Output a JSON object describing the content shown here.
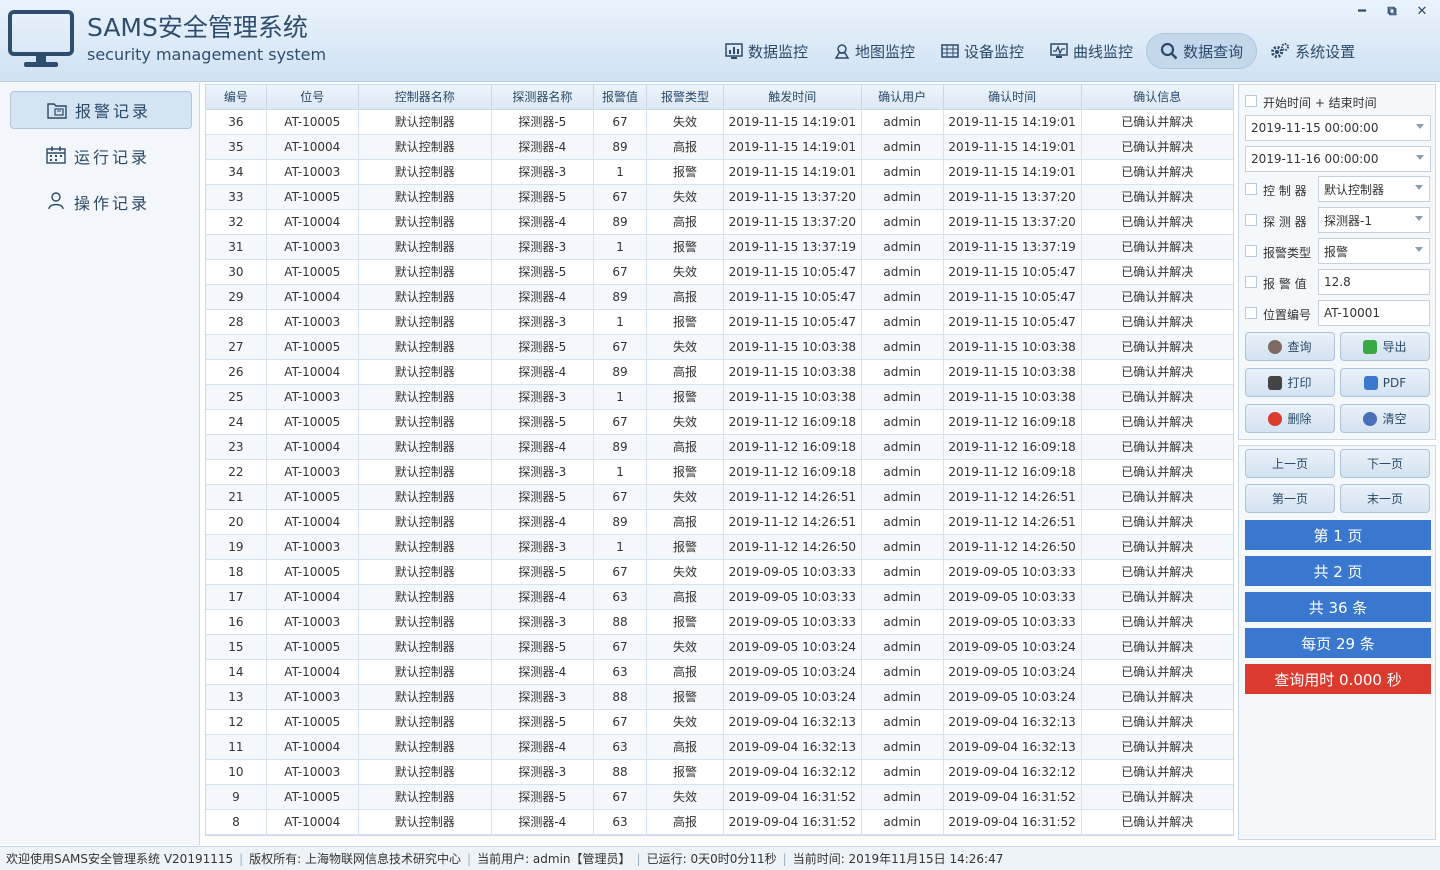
{
  "app": {
    "title": "SAMS安全管理系统",
    "subtitle": "security management system"
  },
  "window_controls": {
    "minimize": "━",
    "restore": "⧉",
    "close": "✕"
  },
  "nav": [
    {
      "label": "数据监控",
      "icon": "bar-chart-icon"
    },
    {
      "label": "地图监控",
      "icon": "map-pin-icon"
    },
    {
      "label": "设备监控",
      "icon": "device-grid-icon"
    },
    {
      "label": "曲线监控",
      "icon": "curve-monitor-icon"
    },
    {
      "label": "数据查询",
      "icon": "search-icon"
    },
    {
      "label": "系统设置",
      "icon": "gear-icon"
    }
  ],
  "nav_active": "数据查询",
  "sidebar": [
    {
      "label": "报警记录",
      "icon": "alarm-record-icon"
    },
    {
      "label": "运行记录",
      "icon": "calendar-icon"
    },
    {
      "label": "操作记录",
      "icon": "user-icon"
    }
  ],
  "table": {
    "columns": [
      "编号",
      "位号",
      "控制器名称",
      "探测器名称",
      "报警值",
      "报警类型",
      "触发时间",
      "确认用户",
      "确认时间",
      "确认信息"
    ],
    "rows": [
      [
        "36",
        "AT-10005",
        "默认控制器",
        "探测器-5",
        "67",
        "失效",
        "2019-11-15 14:19:01",
        "admin",
        "2019-11-15 14:19:01",
        "已确认并解决"
      ],
      [
        "35",
        "AT-10004",
        "默认控制器",
        "探测器-4",
        "89",
        "高报",
        "2019-11-15 14:19:01",
        "admin",
        "2019-11-15 14:19:01",
        "已确认并解决"
      ],
      [
        "34",
        "AT-10003",
        "默认控制器",
        "探测器-3",
        "1",
        "报警",
        "2019-11-15 14:19:01",
        "admin",
        "2019-11-15 14:19:01",
        "已确认并解决"
      ],
      [
        "33",
        "AT-10005",
        "默认控制器",
        "探测器-5",
        "67",
        "失效",
        "2019-11-15 13:37:20",
        "admin",
        "2019-11-15 13:37:20",
        "已确认并解决"
      ],
      [
        "32",
        "AT-10004",
        "默认控制器",
        "探测器-4",
        "89",
        "高报",
        "2019-11-15 13:37:20",
        "admin",
        "2019-11-15 13:37:20",
        "已确认并解决"
      ],
      [
        "31",
        "AT-10003",
        "默认控制器",
        "探测器-3",
        "1",
        "报警",
        "2019-11-15 13:37:19",
        "admin",
        "2019-11-15 13:37:19",
        "已确认并解决"
      ],
      [
        "30",
        "AT-10005",
        "默认控制器",
        "探测器-5",
        "67",
        "失效",
        "2019-11-15 10:05:47",
        "admin",
        "2019-11-15 10:05:47",
        "已确认并解决"
      ],
      [
        "29",
        "AT-10004",
        "默认控制器",
        "探测器-4",
        "89",
        "高报",
        "2019-11-15 10:05:47",
        "admin",
        "2019-11-15 10:05:47",
        "已确认并解决"
      ],
      [
        "28",
        "AT-10003",
        "默认控制器",
        "探测器-3",
        "1",
        "报警",
        "2019-11-15 10:05:47",
        "admin",
        "2019-11-15 10:05:47",
        "已确认并解决"
      ],
      [
        "27",
        "AT-10005",
        "默认控制器",
        "探测器-5",
        "67",
        "失效",
        "2019-11-15 10:03:38",
        "admin",
        "2019-11-15 10:03:38",
        "已确认并解决"
      ],
      [
        "26",
        "AT-10004",
        "默认控制器",
        "探测器-4",
        "89",
        "高报",
        "2019-11-15 10:03:38",
        "admin",
        "2019-11-15 10:03:38",
        "已确认并解决"
      ],
      [
        "25",
        "AT-10003",
        "默认控制器",
        "探测器-3",
        "1",
        "报警",
        "2019-11-15 10:03:38",
        "admin",
        "2019-11-15 10:03:38",
        "已确认并解决"
      ],
      [
        "24",
        "AT-10005",
        "默认控制器",
        "探测器-5",
        "67",
        "失效",
        "2019-11-12 16:09:18",
        "admin",
        "2019-11-12 16:09:18",
        "已确认并解决"
      ],
      [
        "23",
        "AT-10004",
        "默认控制器",
        "探测器-4",
        "89",
        "高报",
        "2019-11-12 16:09:18",
        "admin",
        "2019-11-12 16:09:18",
        "已确认并解决"
      ],
      [
        "22",
        "AT-10003",
        "默认控制器",
        "探测器-3",
        "1",
        "报警",
        "2019-11-12 16:09:18",
        "admin",
        "2019-11-12 16:09:18",
        "已确认并解决"
      ],
      [
        "21",
        "AT-10005",
        "默认控制器",
        "探测器-5",
        "67",
        "失效",
        "2019-11-12 14:26:51",
        "admin",
        "2019-11-12 14:26:51",
        "已确认并解决"
      ],
      [
        "20",
        "AT-10004",
        "默认控制器",
        "探测器-4",
        "89",
        "高报",
        "2019-11-12 14:26:51",
        "admin",
        "2019-11-12 14:26:51",
        "已确认并解决"
      ],
      [
        "19",
        "AT-10003",
        "默认控制器",
        "探测器-3",
        "1",
        "报警",
        "2019-11-12 14:26:50",
        "admin",
        "2019-11-12 14:26:50",
        "已确认并解决"
      ],
      [
        "18",
        "AT-10005",
        "默认控制器",
        "探测器-5",
        "67",
        "失效",
        "2019-09-05 10:03:33",
        "admin",
        "2019-09-05 10:03:33",
        "已确认并解决"
      ],
      [
        "17",
        "AT-10004",
        "默认控制器",
        "探测器-4",
        "63",
        "高报",
        "2019-09-05 10:03:33",
        "admin",
        "2019-09-05 10:03:33",
        "已确认并解决"
      ],
      [
        "16",
        "AT-10003",
        "默认控制器",
        "探测器-3",
        "88",
        "报警",
        "2019-09-05 10:03:33",
        "admin",
        "2019-09-05 10:03:33",
        "已确认并解决"
      ],
      [
        "15",
        "AT-10005",
        "默认控制器",
        "探测器-5",
        "67",
        "失效",
        "2019-09-05 10:03:24",
        "admin",
        "2019-09-05 10:03:24",
        "已确认并解决"
      ],
      [
        "14",
        "AT-10004",
        "默认控制器",
        "探测器-4",
        "63",
        "高报",
        "2019-09-05 10:03:24",
        "admin",
        "2019-09-05 10:03:24",
        "已确认并解决"
      ],
      [
        "13",
        "AT-10003",
        "默认控制器",
        "探测器-3",
        "88",
        "报警",
        "2019-09-05 10:03:24",
        "admin",
        "2019-09-05 10:03:24",
        "已确认并解决"
      ],
      [
        "12",
        "AT-10005",
        "默认控制器",
        "探测器-5",
        "67",
        "失效",
        "2019-09-04 16:32:13",
        "admin",
        "2019-09-04 16:32:13",
        "已确认并解决"
      ],
      [
        "11",
        "AT-10004",
        "默认控制器",
        "探测器-4",
        "63",
        "高报",
        "2019-09-04 16:32:13",
        "admin",
        "2019-09-04 16:32:13",
        "已确认并解决"
      ],
      [
        "10",
        "AT-10003",
        "默认控制器",
        "探测器-3",
        "88",
        "报警",
        "2019-09-04 16:32:12",
        "admin",
        "2019-09-04 16:32:12",
        "已确认并解决"
      ],
      [
        "9",
        "AT-10005",
        "默认控制器",
        "探测器-5",
        "67",
        "失效",
        "2019-09-04 16:31:52",
        "admin",
        "2019-09-04 16:31:52",
        "已确认并解决"
      ],
      [
        "8",
        "AT-10004",
        "默认控制器",
        "探测器-4",
        "63",
        "高报",
        "2019-09-04 16:31:52",
        "admin",
        "2019-09-04 16:31:52",
        "已确认并解决"
      ]
    ]
  },
  "filters": {
    "time_range_label": "开始时间 + 结束时间",
    "start_time": "2019-11-15 00:00:00",
    "end_time": "2019-11-16 00:00:00",
    "controller_label": "控 制 器",
    "controller_value": "默认控制器",
    "detector_label": "探 测 器",
    "detector_value": "探测器-1",
    "alarm_type_label": "报警类型",
    "alarm_type_value": "报警",
    "alarm_value_label": "报 警 值",
    "alarm_value_value": "12.8",
    "position_label": "位置编号",
    "position_value": "AT-10001"
  },
  "actions": {
    "query": "查询",
    "export": "导出",
    "print": "打印",
    "pdf": "PDF",
    "delete": "删除",
    "clear": "清空"
  },
  "pager": {
    "prev": "上一页",
    "next": "下一页",
    "first": "第一页",
    "last": "末一页",
    "current_page": "第 1 页",
    "total_pages": "共 2 页",
    "total_records": "共 36 条",
    "per_page": "每页 29 条",
    "query_time": "查询用时 0.000 秒"
  },
  "status": {
    "welcome": "欢迎使用SAMS安全管理系统 V20191115",
    "copyright": "版权所有: 上海物联网信息技术研究中心",
    "current_user": "当前用户: admin【管理员】",
    "uptime": "已运行: 0天0时0分11秒",
    "current_time": "当前时间: 2019年11月15日 14:26:47"
  },
  "colors": {
    "accent_blue": "#3a78cf",
    "alert_red": "#db3a2f",
    "header_text": "#2f4e6e"
  }
}
